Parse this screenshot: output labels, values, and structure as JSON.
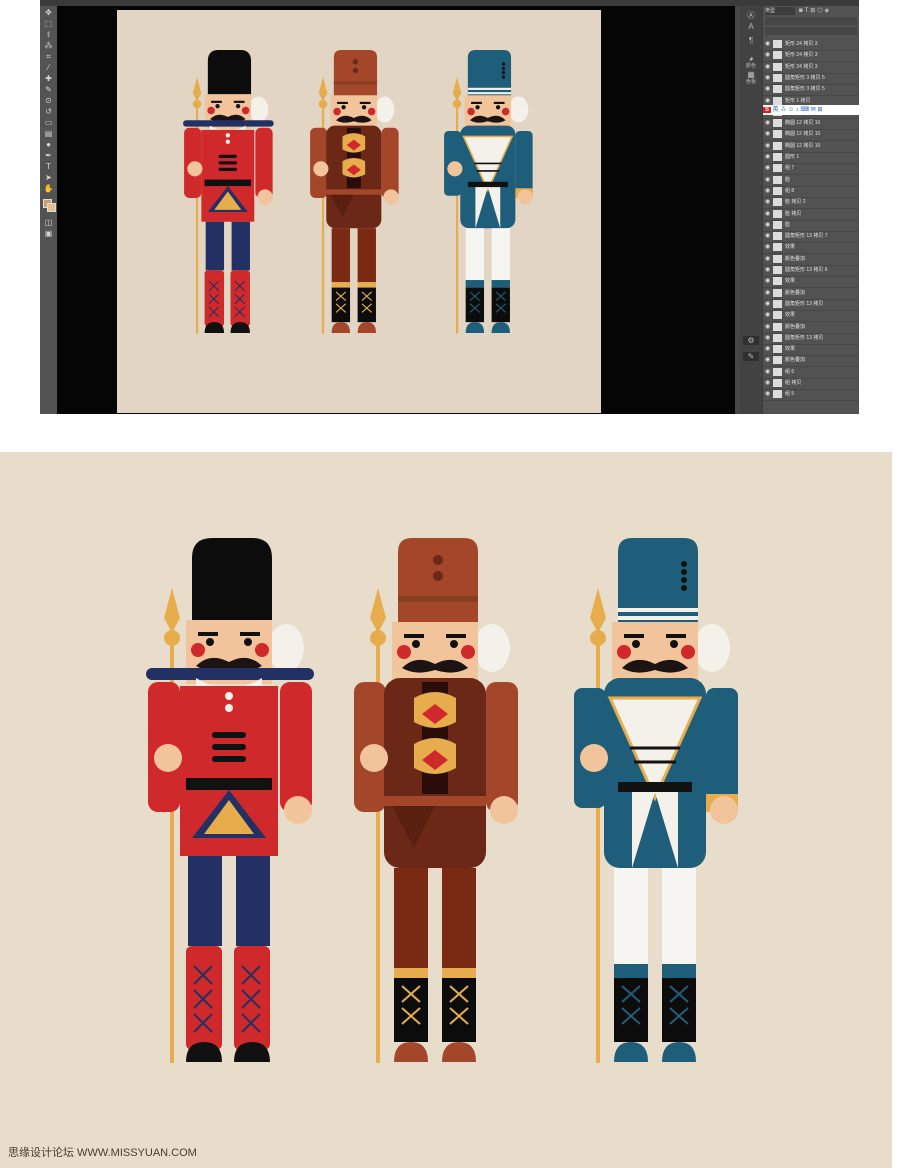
{
  "app": {
    "name": "Photoshop"
  },
  "toolbar": {
    "tools": [
      "move-tool",
      "marquee-tool",
      "lasso-tool",
      "quick-select-tool",
      "crop-tool",
      "eyedropper-tool",
      "healing-tool",
      "brush-tool",
      "clone-tool",
      "history-brush-tool",
      "eraser-tool",
      "gradient-tool",
      "dodge-tool",
      "pen-tool",
      "type-tool",
      "path-select-tool",
      "shape-tool",
      "hand-tool",
      "zoom-tool",
      "more-tool"
    ]
  },
  "panel_icons": [
    {
      "label": "颜色"
    },
    {
      "label": "色板"
    }
  ],
  "layers": {
    "search_placeholder": "类型",
    "rows": [
      {
        "name": "矩形 24 拷贝 3"
      },
      {
        "name": "矩形 24 拷贝 3"
      },
      {
        "name": "矩形 24 拷贝 3"
      },
      {
        "name": "圆角矩形 3 拷贝 5"
      },
      {
        "name": "圆角矩形 3 拷贝 5"
      },
      {
        "name": "矩形 1 拷贝"
      },
      {
        "name": "椭圆 1 拷贝 3"
      },
      {
        "name": "椭圆 12 拷贝 10"
      },
      {
        "name": "椭圆 12 拷贝 10"
      },
      {
        "name": "椭圆 12 拷贝 10"
      },
      {
        "name": "圆形 1"
      },
      {
        "name": "组 7"
      },
      {
        "name": "脸"
      },
      {
        "name": "组 8"
      },
      {
        "name": "脸 拷贝 2"
      },
      {
        "name": "脸 拷贝"
      },
      {
        "name": "脸"
      },
      {
        "name": "圆角矩形 13 拷贝 7"
      },
      {
        "name": "效果"
      },
      {
        "name": "颜色叠加"
      },
      {
        "name": "圆角矩形 13 拷贝 6"
      },
      {
        "name": "效果"
      },
      {
        "name": "颜色叠加"
      },
      {
        "name": "圆角矩形 13 拷贝"
      },
      {
        "name": "效果"
      },
      {
        "name": "颜色叠加"
      },
      {
        "name": "圆角矩形 13 拷贝"
      },
      {
        "name": "效果"
      },
      {
        "name": "颜色叠加"
      },
      {
        "name": "组 6"
      },
      {
        "name": "组 拷贝"
      },
      {
        "name": "组 5"
      }
    ]
  },
  "watermark": "思缘设计论坛 WWW.MISSYUAN.COM",
  "colors": {
    "canvas_bg": "#e2d5c3",
    "poster_bg": "#e8dccb",
    "red": "#d0292b",
    "navy": "#233063",
    "brown": "#8b3f22",
    "teal": "#1f5e7a",
    "gold": "#e7ad4d",
    "skin": "#f2c49b"
  }
}
